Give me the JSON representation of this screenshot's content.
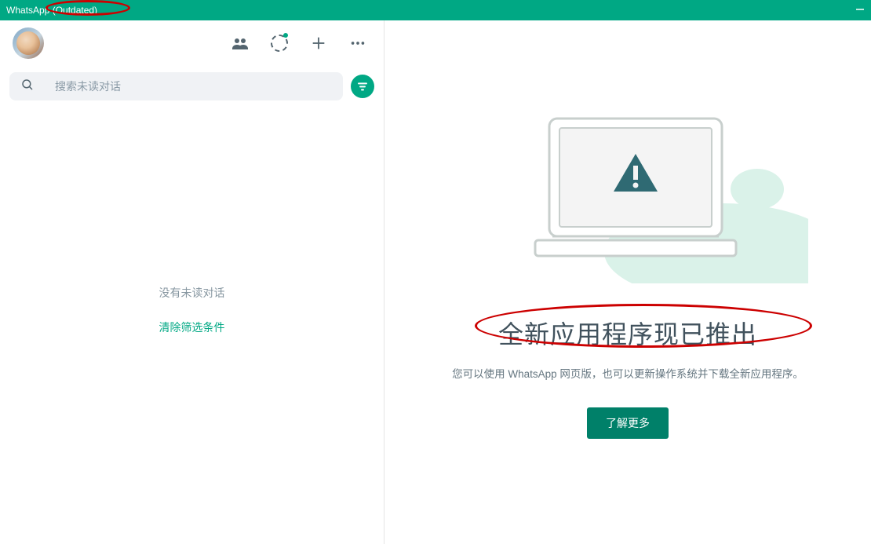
{
  "window": {
    "title": "WhatsApp (Outdated)"
  },
  "sidebar": {
    "search_placeholder": "搜索未读对话",
    "empty_message": "没有未读对话",
    "clear_filter": "清除筛选条件"
  },
  "main": {
    "title": "全新应用程序现已推出",
    "subtitle": "您可以使用 WhatsApp 网页版，也可以更新操作系统并下载全新应用程序。",
    "button": "了解更多"
  }
}
